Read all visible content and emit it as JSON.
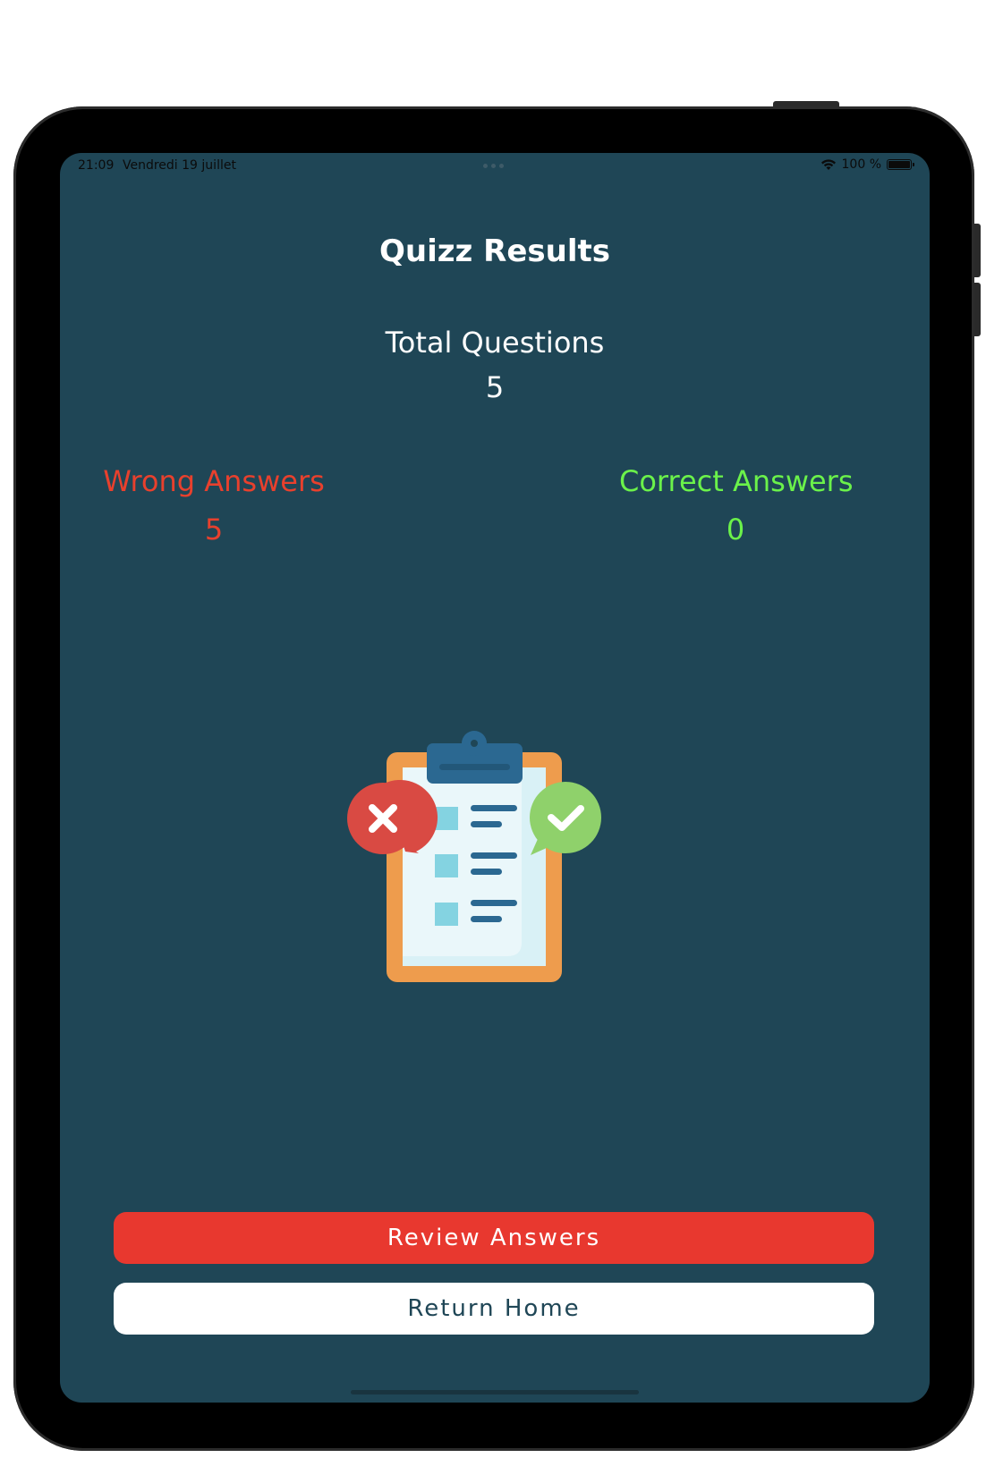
{
  "status_bar": {
    "time": "21:09",
    "date": "Vendredi 19 juillet",
    "battery_text": "100 %",
    "battery_level": 1.0
  },
  "results": {
    "title": "Quizz Results",
    "total_label": "Total Questions",
    "total_value": "5",
    "wrong_label": "Wrong Answers",
    "wrong_value": "5",
    "correct_label": "Correct Answers",
    "correct_value": "0"
  },
  "buttons": {
    "review_label": "Review Answers",
    "home_label": "Return Home"
  },
  "colors": {
    "background": "#1f4656",
    "wrong": "#e8402d",
    "correct": "#6bf24a",
    "review_button": "#e8382f",
    "home_button": "#ffffff"
  },
  "icons": {
    "illustration": "clipboard-checklist-icon",
    "wrong_marker": "x-bubble-icon",
    "correct_marker": "check-bubble-icon",
    "wifi": "wifi-icon",
    "battery": "battery-icon"
  }
}
